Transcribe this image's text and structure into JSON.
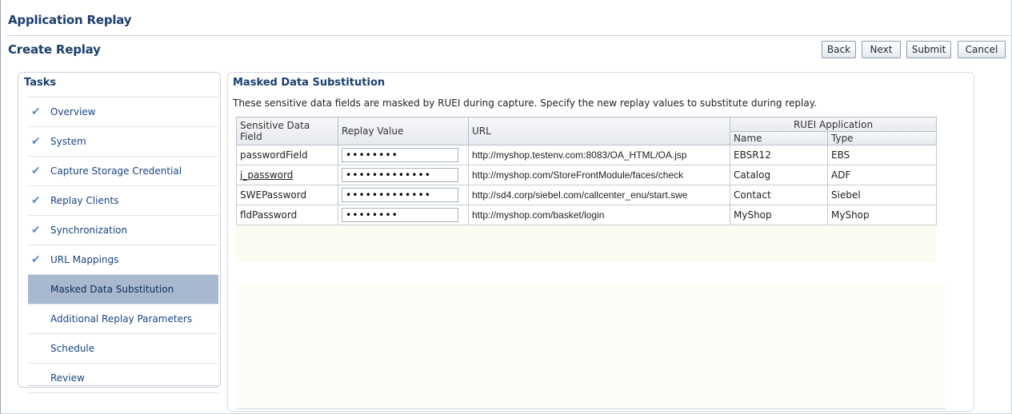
{
  "app": {
    "title": "Application Replay"
  },
  "page": {
    "title": "Create Replay"
  },
  "toolbar": {
    "back": "Back",
    "next": "Next",
    "submit": "Submit",
    "cancel": "Cancel"
  },
  "tasks": {
    "title": "Tasks",
    "items": [
      {
        "label": "Overview",
        "done": true
      },
      {
        "label": "System",
        "done": true
      },
      {
        "label": "Capture Storage Credential",
        "done": true
      },
      {
        "label": "Replay Clients",
        "done": true
      },
      {
        "label": "Synchronization",
        "done": true
      },
      {
        "label": "URL Mappings",
        "done": true
      },
      {
        "label": "Masked Data Substitution",
        "active": true
      },
      {
        "label": "Additional Replay Parameters"
      },
      {
        "label": "Schedule"
      },
      {
        "label": "Review"
      }
    ]
  },
  "main": {
    "title": "Masked Data Substitution",
    "description": "These sensitive data fields are masked by RUEI during capture. Specify the new replay values to substitute during replay.",
    "table": {
      "headers": {
        "field": "Sensitive Data Field",
        "value": "Replay Value",
        "url": "URL",
        "group": "RUEI Application",
        "name": "Name",
        "type": "Type"
      },
      "rows": [
        {
          "field": "passwordField",
          "value": "••••••••",
          "url": "http://myshop.testenv.com:8083/OA_HTML/OA.jsp",
          "name": "EBSR12",
          "type": "EBS"
        },
        {
          "field": "j_password",
          "value": "•••••••••••••",
          "url": "http://myshop.com/StoreFrontModule/faces/check",
          "name": "Catalog",
          "type": "ADF"
        },
        {
          "field": "SWEPassword",
          "value": "•••••••••••••",
          "url": "http://sd4.corp/siebel.com/callcenter_enu/start.swe",
          "name": "Contact",
          "type": "Siebel"
        },
        {
          "field": "fldPassword",
          "value": "••••••••",
          "url": "http://myshop.com/basket/login",
          "name": "MyShop",
          "type": "MyShop"
        }
      ]
    }
  },
  "icons": {
    "completed": "checkmark-icon"
  },
  "colors": {
    "header_text": "#1c3f6e",
    "active_task_bg": "#a7b8cf",
    "link_text": "#1a4480"
  }
}
